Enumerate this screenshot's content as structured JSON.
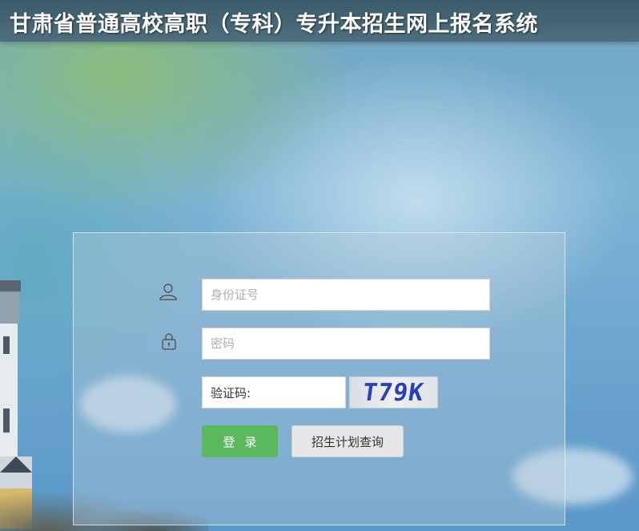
{
  "header": {
    "title": "甘肃省普通高校高职（专科）专升本招生网上报名系统"
  },
  "form": {
    "id_field": {
      "placeholder": "身份证号",
      "icon": "user-icon"
    },
    "password_field": {
      "placeholder": "密码",
      "icon": "lock-icon"
    },
    "captcha_field": {
      "value": "验证码:"
    },
    "captcha_image": {
      "text": "T79K"
    },
    "login_button": {
      "label": "登录"
    },
    "query_button": {
      "label": "招生计划查询"
    }
  },
  "colors": {
    "header_bg": "#3b5a6a",
    "login_button": "#5cb85c",
    "query_button": "#e6e6e6"
  }
}
